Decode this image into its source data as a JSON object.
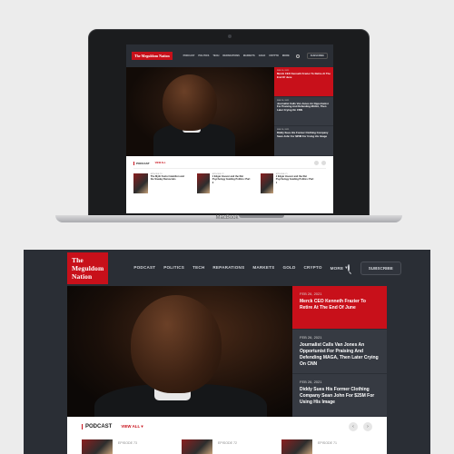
{
  "site": {
    "logo": "The Meguldom Nation",
    "nav": [
      "PODCAST",
      "POLITICS",
      "TECH",
      "REPARATIONS",
      "MARKETS",
      "GOLD",
      "CRYPTO"
    ],
    "more": "MORE",
    "subscribe": "SUBSCRIBE"
  },
  "hero_side": [
    {
      "date": "FEB 26, 2021",
      "title": "Merck CEO Kenneth Frazier To Retire At The End Of June"
    },
    {
      "date": "FEB 26, 2021",
      "title": "Journalist Calls Van Jones An Opportunist For Praising And Defending MAGA, Then Later Crying On CNN"
    },
    {
      "date": "FEB 26, 2021",
      "title": "Diddy Sues His Former Clothing Company Sean John For $25M For Using His Image"
    }
  ],
  "podcast": {
    "label": "PODCAST",
    "view_all": "VIEW ALL",
    "episodes": [
      {
        "number": "EPISODE 73",
        "title": "The Myth Factor Hamilton and the Sneaky Democrats"
      },
      {
        "number": "EPISODE 72",
        "title": "J Edgar Hoover and the Rat Psychology Guiding Politics: Part 2"
      },
      {
        "number": "EPISODE 71",
        "title": "J Edgar Hoover and the Rat Psychology Guiding Politics: Part 1"
      }
    ]
  },
  "device": {
    "brand": "MacBook"
  }
}
